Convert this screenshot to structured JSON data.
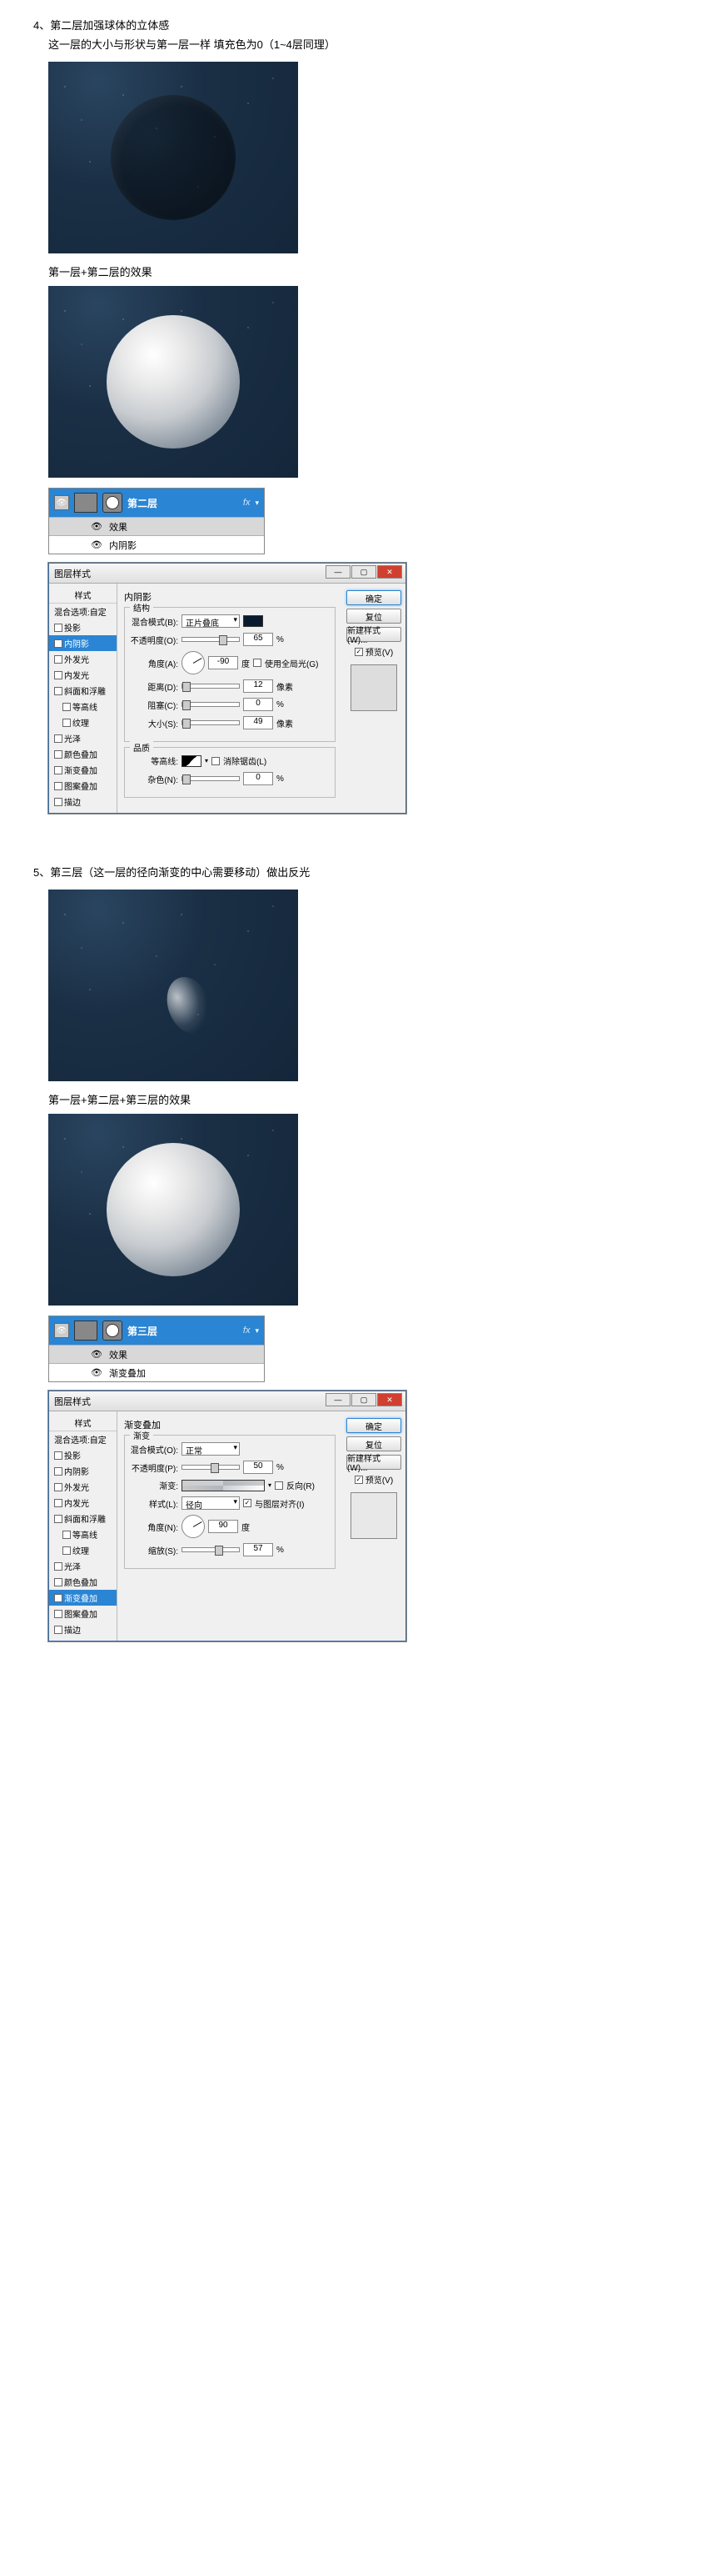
{
  "step4": {
    "title": "4、第二层加强球体的立体感",
    "sub": "这一层的大小与形状与第一层一样   填充色为0（1~4层同理）",
    "cap1": "第一层+第二层的效果"
  },
  "step5": {
    "title": "5、第三层（这一层的径向渐变的中心需要移动）做出反光",
    "cap1": "第一层+第二层+第三层的效果"
  },
  "layers": {
    "name2": "第二层",
    "name3": "第三层",
    "fx": "效果",
    "innerShadow": "内阴影",
    "gradOverlay": "渐变叠加"
  },
  "dialog": {
    "title": "图层样式",
    "ok": "确定",
    "cancel": "复位",
    "newStyle": "新建样式(W)...",
    "preview": "预览(V)",
    "sideHdr": "样式",
    "sideDefault": "混合选项:自定",
    "items": [
      "投影",
      "内阴影",
      "外发光",
      "内发光",
      "斜面和浮雕",
      "等高线",
      "纹理",
      "光泽",
      "颜色叠加",
      "渐变叠加",
      "图案叠加",
      "描边"
    ]
  },
  "innerShadow": {
    "group": "内阴影",
    "structure": "结构",
    "blendMode": "混合模式(B):",
    "blendVal": "正片叠底",
    "opacity": "不透明度(O):",
    "opacityVal": "65",
    "angle": "角度(A):",
    "angleVal": "-90",
    "deg": "度",
    "useGlobal": "使用全局光(G)",
    "distance": "距离(D):",
    "distanceVal": "12",
    "px": "像素",
    "choke": "阻塞(C):",
    "chokeVal": "0",
    "pct": "%",
    "size": "大小(S):",
    "sizeVal": "49",
    "quality": "品质",
    "contour": "等高线:",
    "antiAlias": "消除锯齿(L)",
    "noise": "杂色(N):",
    "noiseVal": "0"
  },
  "gradOverlay": {
    "group": "渐变叠加",
    "sub": "渐变",
    "blendMode": "混合模式(O):",
    "blendVal": "正常",
    "opacity": "不透明度(P):",
    "opacityVal": "50",
    "gradient": "渐变:",
    "reverse": "反向(R)",
    "style": "样式(L):",
    "styleVal": "径向",
    "alignLayer": "与图层对齐(I)",
    "angle": "角度(N):",
    "angleVal": "90",
    "deg": "度",
    "scale": "缩放(S):",
    "scaleVal": "57",
    "pct": "%"
  },
  "fx": "fx"
}
